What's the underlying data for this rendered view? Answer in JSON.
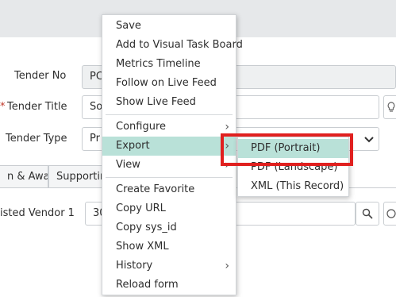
{
  "form": {
    "tender_no_label": "Tender No",
    "tender_no_value": "PC",
    "tender_title_label": "Tender Title",
    "tender_title_value": "So",
    "tender_type_label": "Tender Type",
    "tender_type_value": "Pr",
    "vendor_label": "isted Vendor 1",
    "vendor_value": "30",
    "required_mark": "*"
  },
  "tabs": [
    {
      "label": "n & Award"
    },
    {
      "label": "Supporting"
    }
  ],
  "context_menu": {
    "items": [
      {
        "label": "Save"
      },
      {
        "label": "Add to Visual Task Board"
      },
      {
        "label": "Metrics Timeline"
      },
      {
        "label": "Follow on Live Feed"
      },
      {
        "label": "Show Live Feed"
      },
      {
        "label": "Configure",
        "submenu": true
      },
      {
        "label": "Export",
        "submenu": true,
        "active": true
      },
      {
        "label": "View",
        "submenu": true
      },
      {
        "label": "Create Favorite"
      },
      {
        "label": "Copy URL"
      },
      {
        "label": "Copy sys_id"
      },
      {
        "label": "Show XML"
      },
      {
        "label": "History",
        "submenu": true
      },
      {
        "label": "Reload form"
      }
    ],
    "chevron": "›"
  },
  "export_submenu": {
    "items": [
      {
        "label": "PDF (Portrait)",
        "active": true
      },
      {
        "label": "PDF (Landscape)"
      },
      {
        "label": "XML (This Record)"
      }
    ]
  },
  "colors": {
    "highlight": "#b9e1d8",
    "annotation_box": "#e0201f"
  },
  "icons": {
    "search": "search-icon",
    "dropdown": "chevron-down-icon",
    "lightbulb": "lightbulb-icon"
  }
}
